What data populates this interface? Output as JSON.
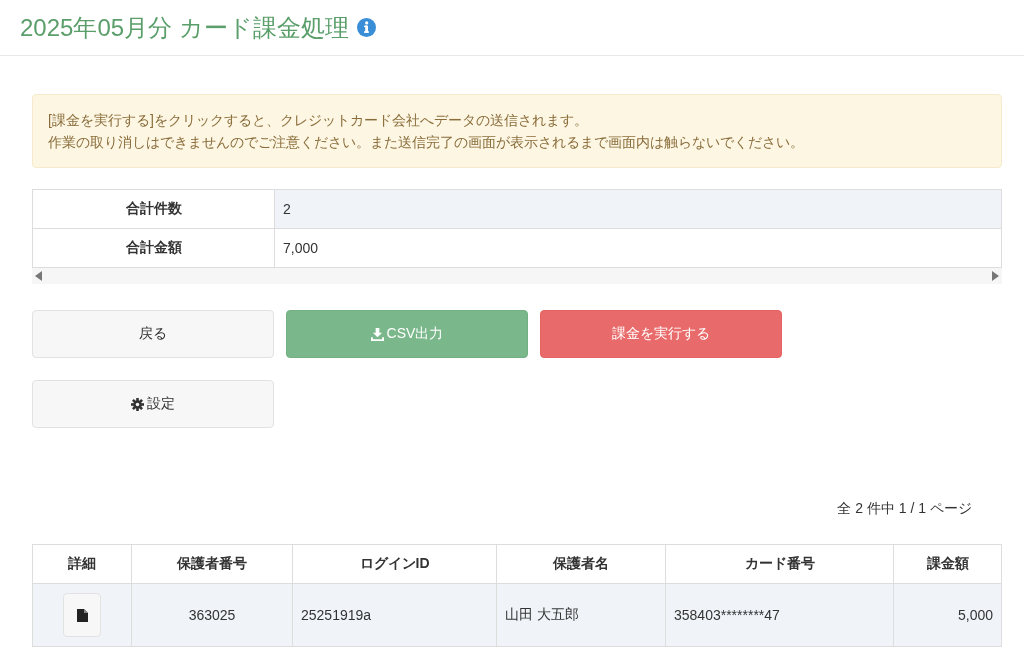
{
  "title": "2025年05月分 カード課金処理",
  "notice": [
    "[課金を実行する]をクリックすると、クレジットカード会社へデータの送信されます。",
    "作業の取り消しはできませんのでご注意ください。また送信完了の画面が表示されるまで画面内は触らないでください。"
  ],
  "summary": [
    {
      "label": "合計件数",
      "value": "2"
    },
    {
      "label": "合計金額",
      "value": "7,000"
    }
  ],
  "buttons": [
    {
      "kind": "back",
      "label": "戻る"
    },
    {
      "kind": "csv",
      "label": "CSV出力"
    },
    {
      "kind": "charge",
      "label": "課金を実行する"
    }
  ],
  "settings_button": {
    "label": "設定"
  },
  "pagination": "全 2 件中 1 / 1 ページ",
  "table": {
    "columns": [
      "詳細",
      "保護者番号",
      "ログインID",
      "保護者名",
      "カード番号",
      "課金額"
    ],
    "rows": [
      {
        "guardian_no": "363025",
        "login_id": "25251919a",
        "name": "山田 大五郎",
        "card": "358403********47",
        "amount": "5,000"
      }
    ]
  }
}
